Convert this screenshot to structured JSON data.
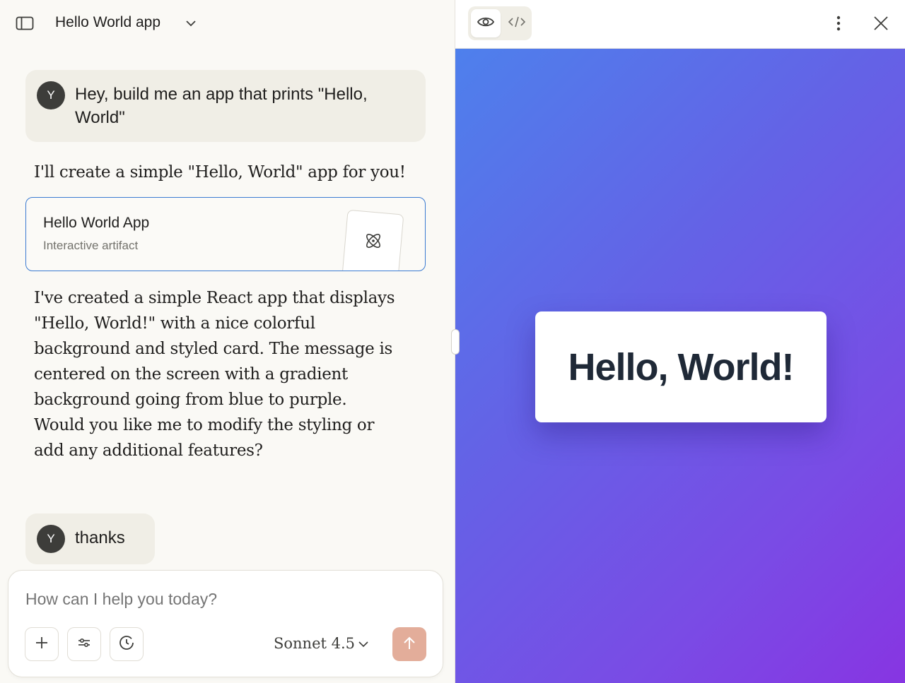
{
  "header": {
    "chat_title": "Hello World app"
  },
  "messages": {
    "user_1": {
      "avatar": "Y",
      "text": "Hey, build me an app that prints \"Hello, World\""
    },
    "assistant_1": "I'll create a simple \"Hello, World\" app for you!",
    "artifact": {
      "title": "Hello World App",
      "subtitle": "Interactive artifact",
      "icon": "atom-icon"
    },
    "assistant_2": "I've created a simple React app that displays \"Hello, World!\" with a nice colorful background and styled card. The message is centered on the screen with a gradient background going from blue to purple. Would you like me to modify the styling or add any additional features?",
    "user_2": {
      "avatar": "Y",
      "text": "thanks"
    }
  },
  "composer": {
    "placeholder": "How can I help you today?",
    "model": "Sonnet 4.5",
    "tools": [
      "plus-icon",
      "sliders-icon",
      "history-icon"
    ],
    "send_icon": "arrow-up-icon"
  },
  "preview": {
    "toolbar_icons": [
      "eye-icon",
      "code-icon",
      "more-vertical-icon",
      "close-icon"
    ],
    "hello_text": "Hello, World!",
    "gradient": [
      "#4e80ec",
      "#8735e2"
    ]
  },
  "colors": {
    "accent_send": "#e3ad9a",
    "artifact_border": "#3b7bd1",
    "user_bubble": "#f0eee6"
  }
}
